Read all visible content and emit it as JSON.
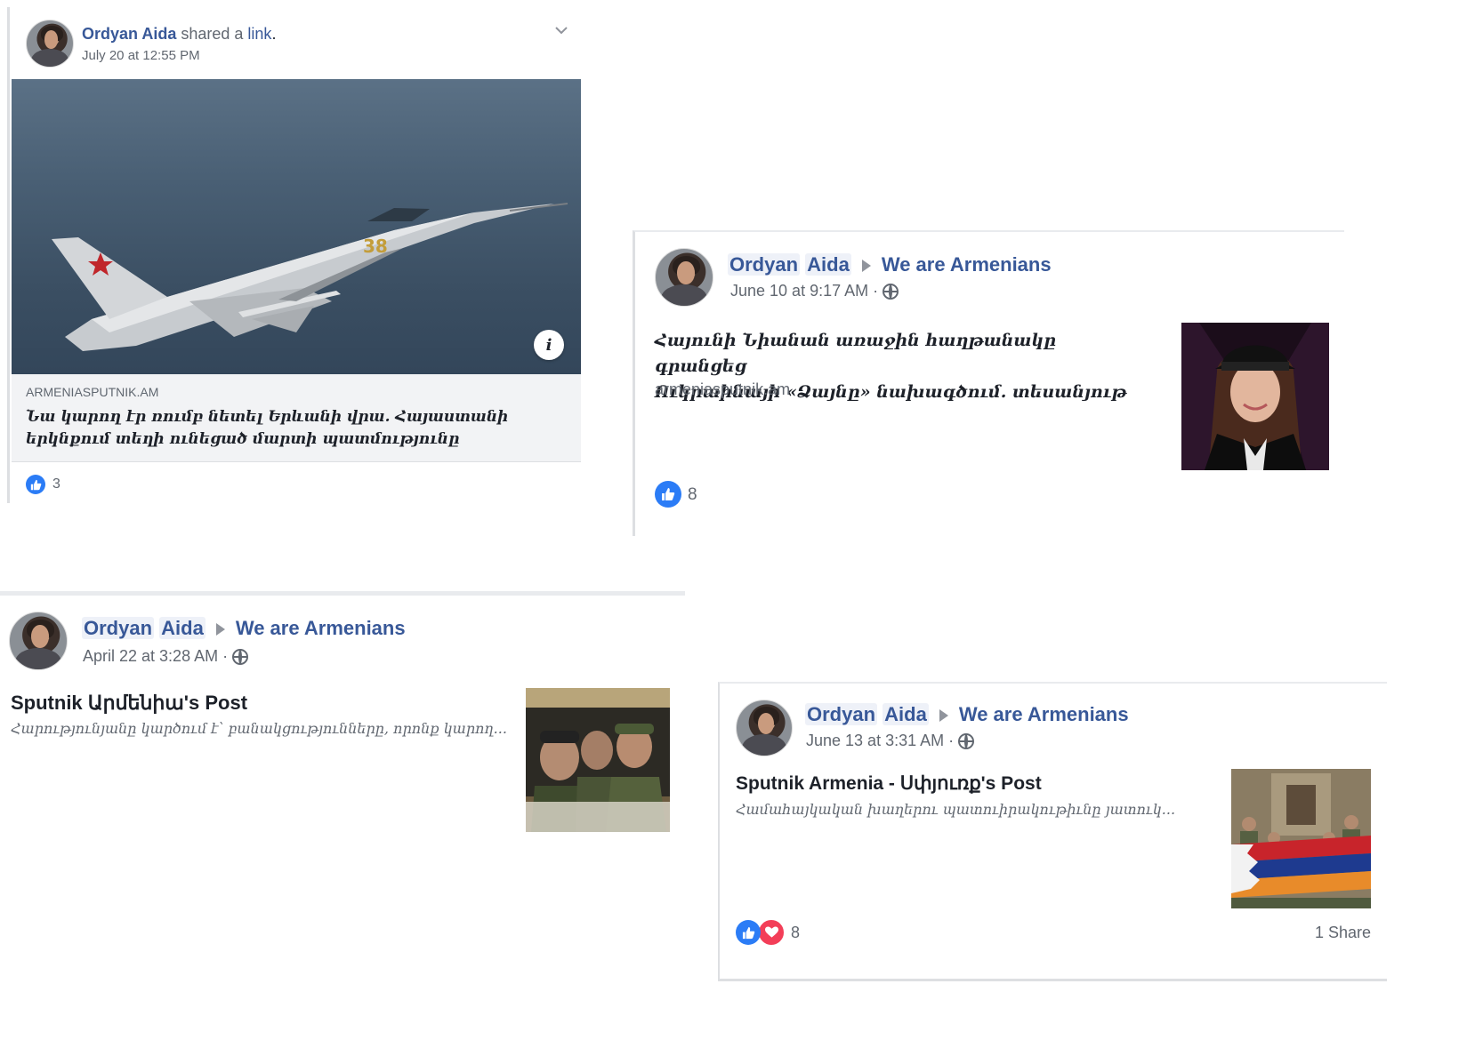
{
  "post1": {
    "author": "Ordyan Aida",
    "action_mid": " shared a ",
    "action_link": "link",
    "action_end": ".",
    "timestamp": "July 20 at 12:55 PM",
    "link_domain": "ARMENIASPUTNIK.AM",
    "link_title": "Նա կարող էր ռումբ նետել Երևանի վրա. Հայաստանի երկնքում տեղի ունեցած մարտի պատմությունը",
    "info_icon": "i",
    "jet_number": "38",
    "likes": "3"
  },
  "post2": {
    "author_first": "Ordyan",
    "author_last": "Aida",
    "group": "We are Armenians",
    "timestamp": "June 10 at 9:17 AM",
    "separator": "·",
    "title_line1": "Հայունի Նիանան առաջին հաղթանակը գրանցեց",
    "title_line2": "Ուկրաինայի «Ձայնը» նախագծում. տեսանյութ",
    "domain": "armeniasputnik.am",
    "likes": "8"
  },
  "post3": {
    "author_first": "Ordyan",
    "author_last": "Aida",
    "group": "We are Armenians",
    "timestamp": "April 22 at 3:28 AM",
    "separator": "·",
    "title": "Sputnik Արմենիա's Post",
    "snippet": "Հարությունյանը կարծում է՝ բանակցությունները, որոնք կարող..."
  },
  "post4": {
    "author_first": "Ordyan",
    "author_last": "Aida",
    "group": "We are Armenians",
    "timestamp": "June 13 at 3:31 AM",
    "separator": "·",
    "title": "Sputnik Armenia - Սփյուռք's Post",
    "snippet": "Համահայկական խաղերու պատուիրակութիւնը յատուկ...",
    "reactions": "8",
    "shares": "1 Share"
  },
  "colors": {
    "link_blue": "#385898",
    "meta_gray": "#616770",
    "like_blue": "#2b7cf6",
    "love_red": "#f33e58"
  },
  "icons": [
    "chevron-down-icon",
    "info-icon",
    "like-icon",
    "love-icon",
    "globe-icon",
    "arrow-right-icon"
  ]
}
